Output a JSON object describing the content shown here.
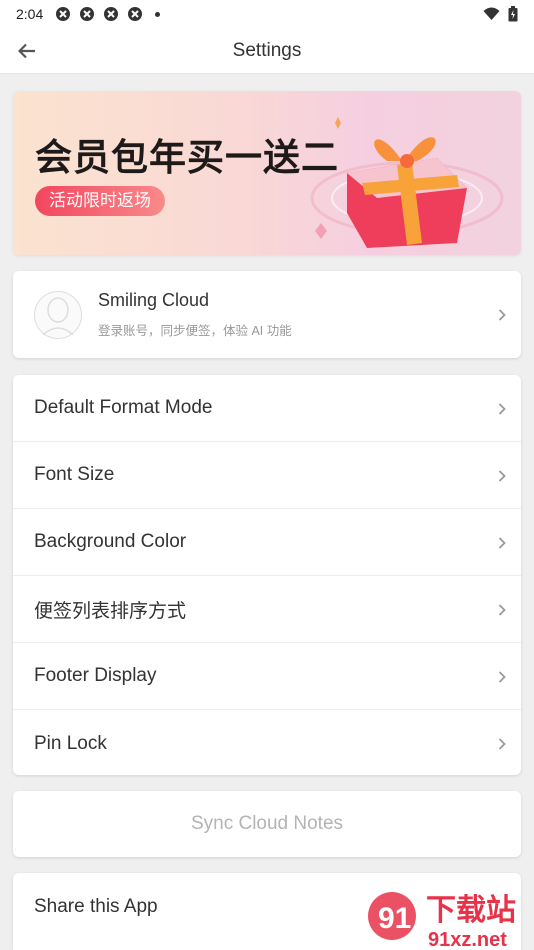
{
  "status_bar": {
    "time": "2:04",
    "notification_icons": [
      "app-notification-icon",
      "app-notification-icon",
      "app-notification-icon",
      "app-notification-icon"
    ],
    "right_icons": [
      "wifi-icon",
      "battery-icon"
    ]
  },
  "header": {
    "title": "Settings",
    "back_icon": "arrow-left-icon"
  },
  "banner": {
    "headline": "会员包年买一送二",
    "tag": "活动限时返场",
    "image": "gift-box-illustration"
  },
  "account": {
    "name": "Smiling Cloud",
    "subtitle": "登录账号，同步便签，体验 AI 功能",
    "avatar_icon": "avatar-placeholder-icon"
  },
  "settings": {
    "items": [
      {
        "label": "Default Format Mode"
      },
      {
        "label": "Font Size"
      },
      {
        "label": "Background Color"
      },
      {
        "label": "便签列表排序方式"
      },
      {
        "label": "Footer Display"
      },
      {
        "label": "Pin Lock"
      }
    ]
  },
  "sync": {
    "label": "Sync Cloud Notes"
  },
  "share": {
    "label": "Share this App"
  },
  "watermark": {
    "text": "下载站",
    "site": "91xz.net"
  },
  "colors": {
    "background": "#efefef",
    "card": "#ffffff",
    "accent_red": "#f2465f",
    "disabled_text": "#b4b4b4"
  }
}
